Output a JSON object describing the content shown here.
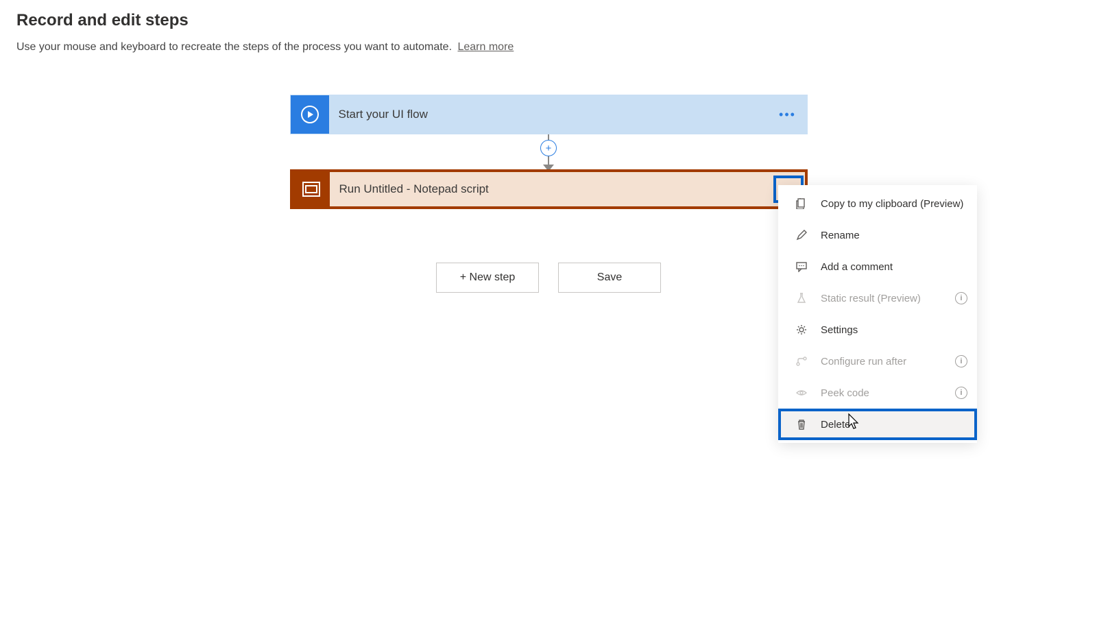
{
  "header": {
    "title": "Record and edit steps",
    "subtitle": "Use your mouse and keyboard to recreate the steps of the process you want to automate.",
    "learn_more": "Learn more"
  },
  "flow": {
    "start_label": "Start your UI flow",
    "run_label": "Run Untitled - Notepad script"
  },
  "buttons": {
    "new_step": "+ New step",
    "save": "Save"
  },
  "menu": {
    "copy": "Copy to my clipboard (Preview)",
    "rename": "Rename",
    "comment": "Add a comment",
    "static_result": "Static result (Preview)",
    "settings": "Settings",
    "configure": "Configure run after",
    "peek": "Peek code",
    "delete": "Delete"
  }
}
